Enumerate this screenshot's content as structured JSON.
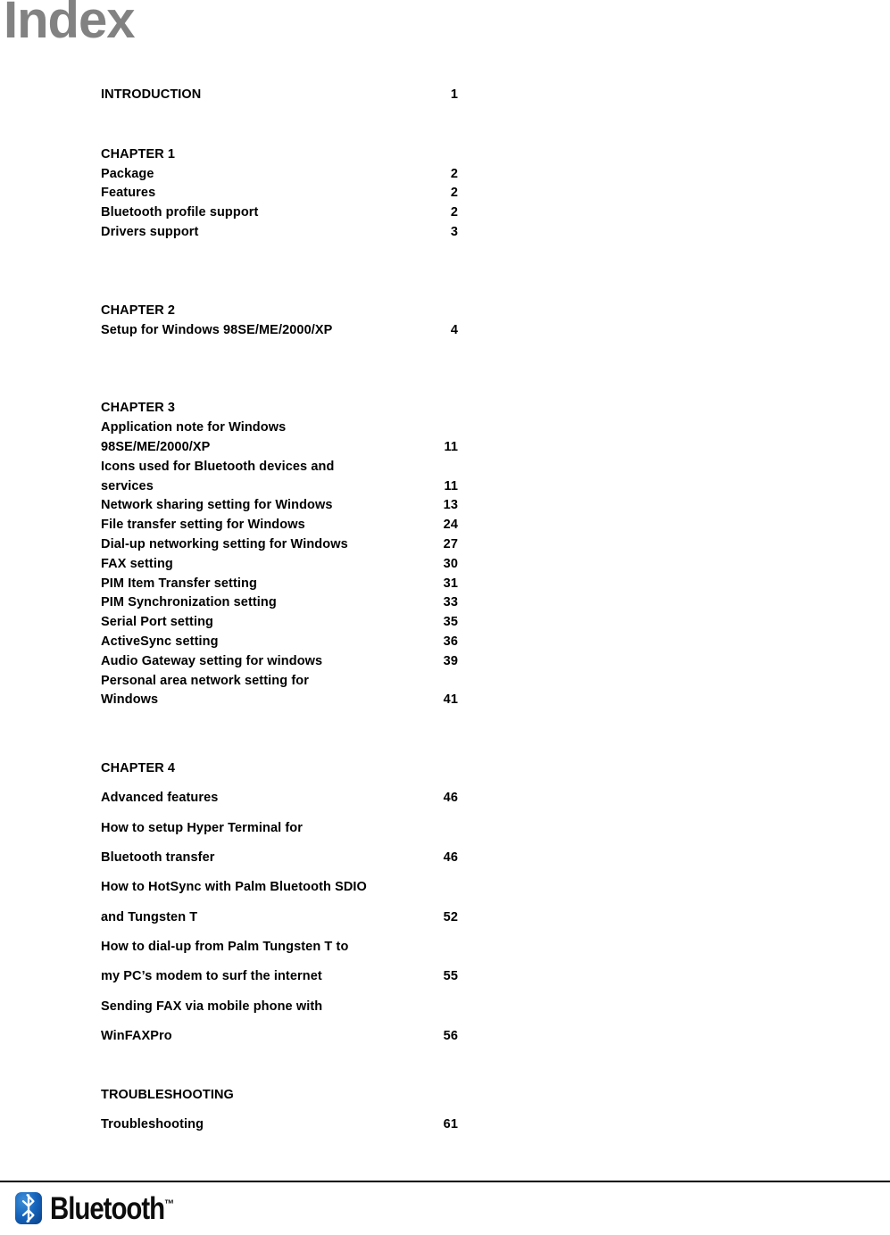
{
  "document": {
    "title": "Index"
  },
  "toc": {
    "groups": [
      {
        "id": "intro",
        "spacing": "tight",
        "entries": [
          {
            "label": "INTRODUCTION",
            "page": "1"
          }
        ]
      },
      {
        "id": "chapter-1",
        "spacing": "tight",
        "entries": [
          {
            "label": "CHAPTER 1",
            "page": ""
          },
          {
            "label": "Package",
            "page": "2"
          },
          {
            "label": "Features",
            "page": "2"
          },
          {
            "label": "Bluetooth profile support",
            "page": "2"
          },
          {
            "label": "Drivers support",
            "page": "3"
          }
        ]
      },
      {
        "id": "chapter-2",
        "spacing": "tight",
        "entries": [
          {
            "label": "CHAPTER 2",
            "page": ""
          },
          {
            "label": "Setup for Windows 98SE/ME/2000/XP",
            "page": "4"
          }
        ]
      },
      {
        "id": "chapter-3",
        "spacing": "tight",
        "entries": [
          {
            "label": "CHAPTER 3",
            "page": ""
          },
          {
            "label": "Application note for Windows",
            "page": ""
          },
          {
            "label": "98SE/ME/2000/XP",
            "page": "11"
          },
          {
            "label": "Icons used for Bluetooth devices and",
            "page": ""
          },
          {
            "label": "services",
            "page": "11"
          },
          {
            "label": "Network sharing setting for Windows",
            "page": "13"
          },
          {
            "label": "File transfer setting for Windows",
            "page": "24"
          },
          {
            "label": "Dial-up networking setting for Windows",
            "page": "27"
          },
          {
            "label": "FAX setting",
            "page": "30"
          },
          {
            "label": "PIM Item Transfer setting",
            "page": "31"
          },
          {
            "label": "PIM Synchronization setting",
            "page": "33"
          },
          {
            "label": "Serial Port setting",
            "page": "35"
          },
          {
            "label": "ActiveSync setting",
            "page": "36"
          },
          {
            "label": "Audio Gateway setting for windows",
            "page": "39"
          },
          {
            "label": "Personal area network setting for",
            "page": ""
          },
          {
            "label": "Windows",
            "page": "41"
          }
        ]
      },
      {
        "id": "chapter-4",
        "spacing": "loose",
        "entries": [
          {
            "label": "CHAPTER 4",
            "page": ""
          },
          {
            "label": "Advanced features",
            "page": "46"
          },
          {
            "label": "How to setup Hyper Terminal for",
            "page": ""
          },
          {
            "label": "Bluetooth transfer",
            "page": "46"
          },
          {
            "label": "How to HotSync with Palm Bluetooth SDIO",
            "page": ""
          },
          {
            "label": "and Tungsten T",
            "page": "52"
          },
          {
            "label": "How to dial-up from Palm Tungsten T to",
            "page": ""
          },
          {
            "label": "my PC’s modem to surf the internet",
            "page": "55"
          },
          {
            "label": "Sending FAX via mobile phone with",
            "page": ""
          },
          {
            "label": "WinFAXPro",
            "page": "56"
          }
        ]
      },
      {
        "id": "troubleshooting",
        "spacing": "loose",
        "entries": [
          {
            "label": "TROUBLESHOOTING",
            "page": ""
          },
          {
            "label": "Troubleshooting",
            "page": "61"
          }
        ]
      }
    ]
  },
  "footer": {
    "logo_wordmark": "Bluetooth",
    "logo_trademark": "™",
    "logo_icon": "bluetooth-rune-icon",
    "logo_color": "#1565bd"
  }
}
